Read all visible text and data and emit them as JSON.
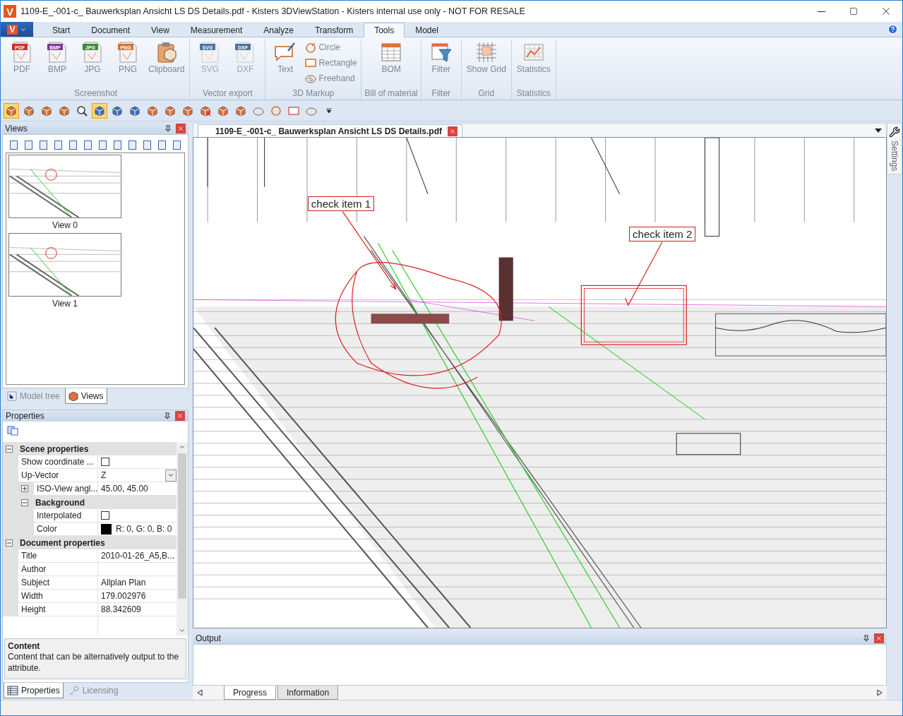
{
  "window": {
    "logo": "V",
    "title": "1109-E_-001-c_ Bauwerksplan Ansicht  LS  DS  Details.pdf - Kisters 3DViewStation - Kisters internal use only - NOT FOR RESALE"
  },
  "menu": {
    "app_button": "V",
    "tabs": [
      {
        "label": "Start",
        "selected": false
      },
      {
        "label": "Document",
        "selected": false
      },
      {
        "label": "View",
        "selected": false
      },
      {
        "label": "Measurement",
        "selected": false
      },
      {
        "label": "Analyze",
        "selected": false
      },
      {
        "label": "Transform",
        "selected": false
      },
      {
        "label": "Tools",
        "selected": true
      },
      {
        "label": "Model",
        "selected": false
      }
    ]
  },
  "ribbon": [
    {
      "label": "Screenshot",
      "items": [
        {
          "kind": "large",
          "label": "PDF",
          "badge": "PDF",
          "disabled": false
        },
        {
          "kind": "large",
          "label": "BMP",
          "badge": "BMP",
          "disabled": false
        },
        {
          "kind": "large",
          "label": "JPG",
          "badge": "JPG",
          "disabled": false
        },
        {
          "kind": "large",
          "label": "PNG",
          "badge": "PNG",
          "disabled": false
        },
        {
          "kind": "large",
          "label": "Clipboard",
          "disabled": false
        }
      ]
    },
    {
      "label": "Vector export",
      "items": [
        {
          "kind": "large",
          "label": "SVG",
          "badge": "SVG",
          "disabled": true
        },
        {
          "kind": "large",
          "label": "DXF",
          "badge": "DXF",
          "disabled": true
        }
      ]
    },
    {
      "label": "3D Markup",
      "items": [
        {
          "kind": "large",
          "label": "Text",
          "disabled": false
        },
        {
          "kind": "small",
          "label": "Circle",
          "disabled": false
        },
        {
          "kind": "small",
          "label": "Rectangle",
          "disabled": false
        },
        {
          "kind": "small",
          "label": "Freehand",
          "disabled": false
        }
      ]
    },
    {
      "label": "Bill of material",
      "items": [
        {
          "kind": "large",
          "label": "BOM",
          "disabled": false
        }
      ]
    },
    {
      "label": "Filter",
      "items": [
        {
          "kind": "large",
          "label": "Filter",
          "disabled": false
        }
      ]
    },
    {
      "label": "Grid",
      "items": [
        {
          "kind": "large",
          "label": "Show Grid",
          "disabled": false
        }
      ]
    },
    {
      "label": "Statistics",
      "items": [
        {
          "kind": "large",
          "label": "Statistics",
          "disabled": false
        }
      ]
    }
  ],
  "quick_toolbar": [
    {
      "selected": true
    },
    {
      "selected": false
    },
    {
      "selected": false
    },
    {
      "selected": false
    },
    {
      "selected": false
    },
    {
      "selected": true
    },
    {
      "selected": false
    },
    {
      "selected": false
    },
    {
      "selected": false
    },
    {
      "selected": false
    },
    {
      "selected": false
    },
    {
      "selected": false
    },
    {
      "selected": false
    },
    {
      "selected": false
    },
    {
      "selected": false
    },
    {
      "selected": false
    },
    {
      "selected": false
    },
    {
      "selected": false
    },
    {
      "selected": false
    }
  ],
  "views_panel": {
    "title": "Views",
    "views": [
      {
        "label": "View 0"
      },
      {
        "label": "View 1"
      }
    ],
    "tabs": [
      {
        "label": "Model tree",
        "selected": false
      },
      {
        "label": "Views",
        "selected": true
      }
    ]
  },
  "properties_panel": {
    "title": "Properties",
    "sections": [
      {
        "title": "Scene properties",
        "expanded": true,
        "rows": [
          {
            "kind": "checkbox",
            "label": "Show coordinate ...",
            "checked": false
          },
          {
            "kind": "dropdown",
            "label": "Up-Vector",
            "value": "Z"
          },
          {
            "kind": "group",
            "label": "ISO-View angl...",
            "value": "45.00, 45.00",
            "expanded": false
          },
          {
            "kind": "header",
            "label": "Background",
            "expanded": true,
            "rows": [
              {
                "kind": "checkbox",
                "label": "Interpolated",
                "checked": false
              },
              {
                "kind": "color",
                "label": "Color",
                "color": "#000000",
                "value": "R: 0, G: 0, B: 0"
              }
            ]
          }
        ]
      },
      {
        "title": "Document properties",
        "expanded": true,
        "rows": [
          {
            "kind": "text",
            "label": "Title",
            "value": "2010-01-26_A5,B..."
          },
          {
            "kind": "text",
            "label": "Author"
          },
          {
            "kind": "text",
            "label": "Subject",
            "value": "Allplan Plan"
          },
          {
            "kind": "text",
            "label": "Width",
            "value": "179.002976"
          },
          {
            "kind": "text",
            "label": "Height",
            "value": "88.342609"
          }
        ]
      }
    ],
    "description": {
      "title": "Content",
      "text": "Content that can be alternatively output to the attribute."
    },
    "tabs": [
      {
        "label": "Properties",
        "selected": true
      },
      {
        "label": "Licensing",
        "selected": false
      }
    ]
  },
  "document": {
    "tab": "1109-E_-001-c_ Bauwerksplan Ansicht  LS  DS  Details.pdf",
    "markups": [
      {
        "label": "check item 1"
      },
      {
        "label": "check item 2"
      }
    ]
  },
  "side_tab": "Settings",
  "output_panel": {
    "title": "Output",
    "tabs": [
      {
        "label": "Progress",
        "selected": true
      },
      {
        "label": "Information",
        "selected": false
      }
    ]
  }
}
